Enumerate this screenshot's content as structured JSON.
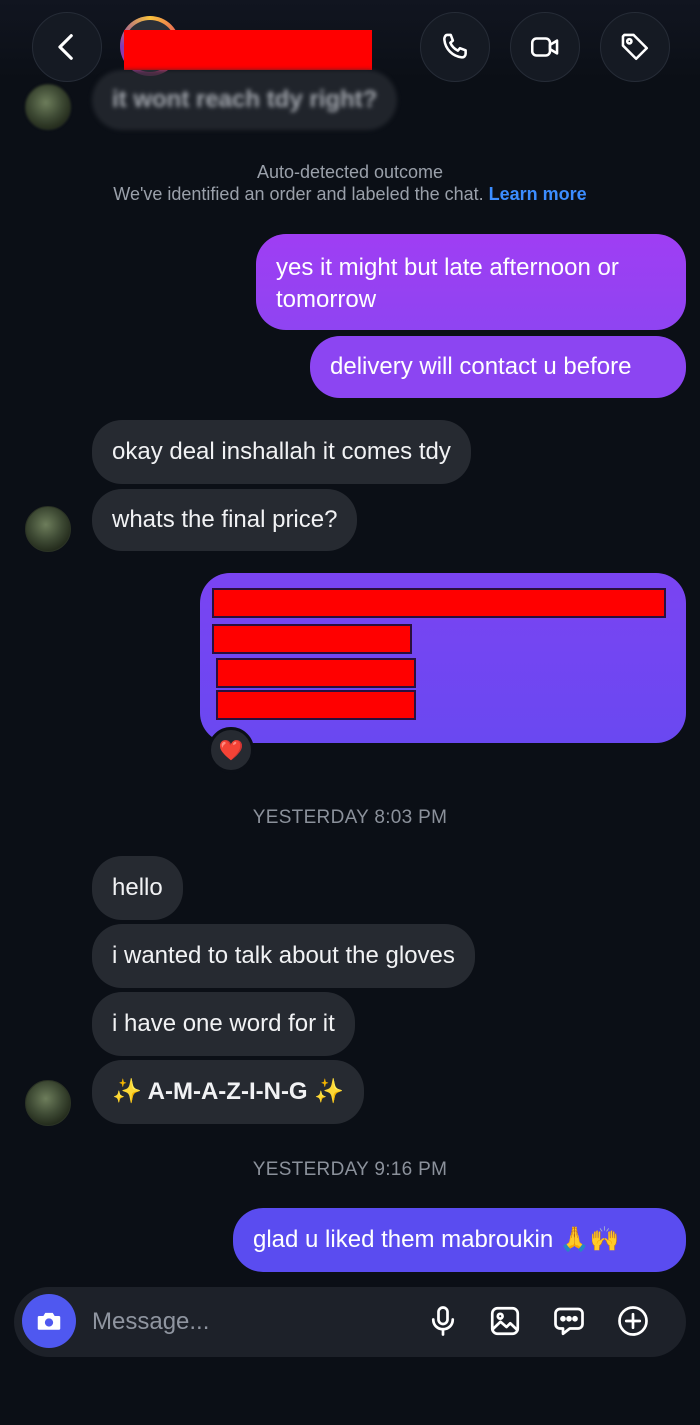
{
  "header": {
    "back_icon": "chevron-left-icon",
    "call_icon": "phone-icon",
    "video_icon": "video-camera-icon",
    "label_icon": "tag-icon"
  },
  "messages_top": {
    "blurred_preview": "it wont reach tdy right?"
  },
  "system_notice": {
    "title": "Auto-detected outcome",
    "body": "We've identified an order and labeled the chat.",
    "link": "Learn more"
  },
  "thread": {
    "out_1_line1": "yes it might but late afternoon or",
    "out_1_line2": "tomorrow",
    "out_2": "delivery will contact u before",
    "in_1": "okay deal inshallah it comes tdy",
    "in_2": "whats the final price?",
    "reaction": "❤️",
    "timestamp_1": "YESTERDAY 8:03 PM",
    "in_3": "hello",
    "in_4": "i wanted to talk about the gloves",
    "in_5": "i have one word for it",
    "in_6": "✨ A-M-A-Z-I-N-G ✨",
    "timestamp_2": "YESTERDAY 9:16 PM",
    "out_3": "glad u liked them mabroukin 🙏🙌"
  },
  "composer": {
    "placeholder": "Message...",
    "camera_icon": "camera-icon",
    "mic_icon": "microphone-icon",
    "gallery_icon": "image-icon",
    "sticker_icon": "chat-sticker-icon",
    "more_icon": "plus-circle-icon"
  },
  "colors": {
    "background": "#0b0f16",
    "incoming_bubble": "#262a31",
    "outgoing_purple": "#9b3df0",
    "outgoing_blue": "#5a4cf0",
    "link": "#3c8dff",
    "redaction": "#ff0000"
  }
}
